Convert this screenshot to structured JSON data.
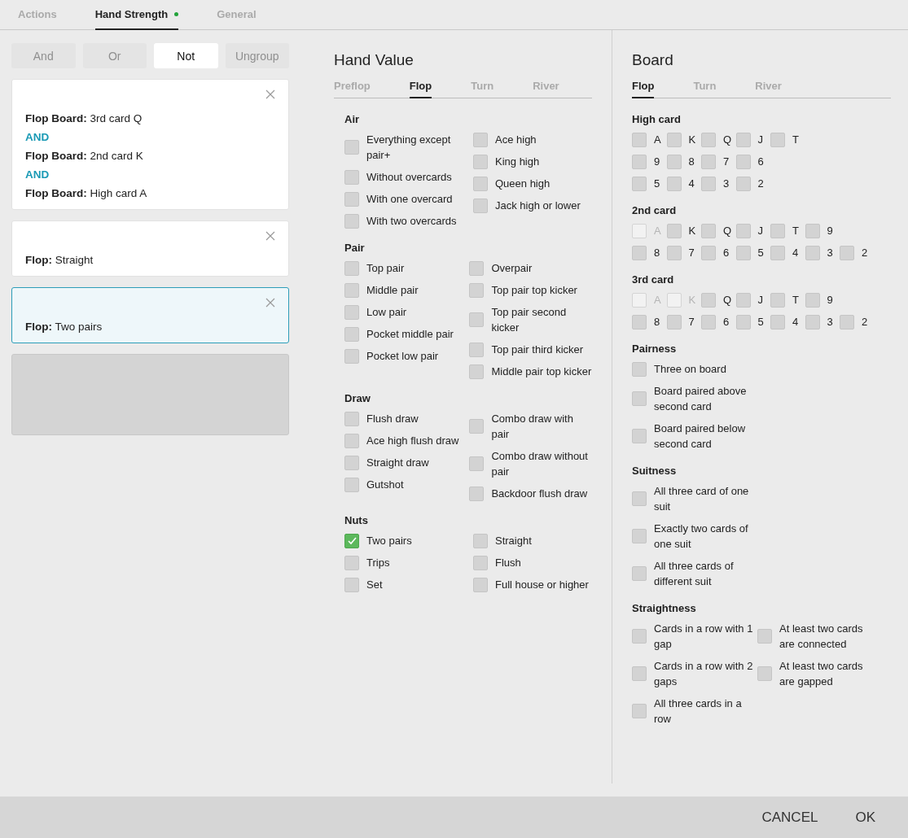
{
  "tabs": [
    {
      "label": "Actions",
      "selected": false,
      "dot": false
    },
    {
      "label": "Hand Strength",
      "selected": true,
      "dot": true
    },
    {
      "label": "General",
      "selected": false,
      "dot": false
    }
  ],
  "logic_buttons": [
    {
      "label": "And",
      "disabled": true
    },
    {
      "label": "Or",
      "disabled": true
    },
    {
      "label": "Not",
      "disabled": false
    },
    {
      "label": "Ungroup",
      "disabled": true
    }
  ],
  "conditions": [
    {
      "selected": false,
      "lines": [
        {
          "kind": "condition",
          "text": "**Flop Board:** 3rd card Q"
        },
        {
          "kind": "operator",
          "text": "AND"
        },
        {
          "kind": "condition",
          "text": "**Flop Board:** 2nd card K"
        },
        {
          "kind": "operator",
          "text": "AND"
        },
        {
          "kind": "condition",
          "text": "**Flop Board:** High card A"
        }
      ]
    },
    {
      "selected": false,
      "lines": [
        {
          "kind": "condition",
          "text": "**Flop:** Straight"
        }
      ]
    },
    {
      "selected": true,
      "lines": [
        {
          "kind": "condition",
          "text": "**Flop:** Two pairs"
        }
      ]
    }
  ],
  "hand_value": {
    "title": "Hand Value",
    "tabs": [
      {
        "label": "Preflop",
        "selected": false
      },
      {
        "label": "Flop",
        "selected": true
      },
      {
        "label": "Turn",
        "selected": false
      },
      {
        "label": "River",
        "selected": false
      }
    ],
    "sections": [
      {
        "title": "Air",
        "columns": [
          [
            {
              "label": "Everything except pair+",
              "checked": false
            },
            {
              "label": "Without overcards",
              "checked": false
            },
            {
              "label": "With one overcard",
              "checked": false
            },
            {
              "label": "With two overcards",
              "checked": false
            }
          ],
          [
            {
              "label": "Ace high",
              "checked": false
            },
            {
              "label": "King high",
              "checked": false
            },
            {
              "label": "Queen high",
              "checked": false
            },
            {
              "label": "Jack high or lower",
              "checked": false
            }
          ]
        ]
      },
      {
        "title": "Pair",
        "columns": [
          [
            {
              "label": "Top pair",
              "checked": false
            },
            {
              "label": "Middle pair",
              "checked": false
            },
            {
              "label": "Low pair",
              "checked": false
            },
            {
              "label": "Pocket middle pair",
              "checked": false
            },
            {
              "label": "Pocket low pair",
              "checked": false
            }
          ],
          [
            {
              "label": "Overpair",
              "checked": false
            },
            {
              "label": "Top pair top kicker",
              "checked": false
            },
            {
              "label": "Top pair second kicker",
              "checked": false
            },
            {
              "label": "Top pair third kicker",
              "checked": false
            },
            {
              "label": "Middle pair top kicker",
              "checked": false
            }
          ]
        ]
      },
      {
        "title": "Draw",
        "columns": [
          [
            {
              "label": "Flush draw",
              "checked": false
            },
            {
              "label": "Ace high flush draw",
              "checked": false
            },
            {
              "label": "Straight draw",
              "checked": false
            },
            {
              "label": "Gutshot",
              "checked": false
            }
          ],
          [
            {
              "label": "Combo draw with pair",
              "checked": false
            },
            {
              "label": "Combo draw without pair",
              "checked": false
            },
            {
              "label": "Backdoor flush draw",
              "checked": false
            }
          ]
        ]
      },
      {
        "title": "Nuts",
        "columns": [
          [
            {
              "label": "Two pairs",
              "checked": true
            },
            {
              "label": "Trips",
              "checked": false
            },
            {
              "label": "Set",
              "checked": false
            }
          ],
          [
            {
              "label": "Straight",
              "checked": false
            },
            {
              "label": "Flush",
              "checked": false
            },
            {
              "label": "Full house or higher",
              "checked": false
            }
          ]
        ]
      }
    ]
  },
  "board": {
    "title": "Board",
    "tabs": [
      {
        "label": "Flop",
        "selected": true
      },
      {
        "label": "Turn",
        "selected": false
      },
      {
        "label": "River",
        "selected": false
      }
    ],
    "sections": [
      {
        "title": "High card",
        "kind": "cards",
        "rows": [
          [
            {
              "label": "A",
              "checked": false,
              "disabled": false
            },
            {
              "label": "K",
              "checked": false,
              "disabled": false
            },
            {
              "label": "Q",
              "checked": false,
              "disabled": false
            },
            {
              "label": "J",
              "checked": false,
              "disabled": false
            },
            {
              "label": "T",
              "checked": false,
              "disabled": false
            }
          ],
          [
            {
              "label": "9",
              "checked": false,
              "disabled": false
            },
            {
              "label": "8",
              "checked": false,
              "disabled": false
            },
            {
              "label": "7",
              "checked": false,
              "disabled": false
            },
            {
              "label": "6",
              "checked": false,
              "disabled": false
            }
          ],
          [
            {
              "label": "5",
              "checked": false,
              "disabled": false
            },
            {
              "label": "4",
              "checked": false,
              "disabled": false
            },
            {
              "label": "3",
              "checked": false,
              "disabled": false
            },
            {
              "label": "2",
              "checked": false,
              "disabled": false
            }
          ]
        ]
      },
      {
        "title": "2nd card",
        "kind": "cards",
        "rows": [
          [
            {
              "label": "A",
              "checked": false,
              "disabled": true
            },
            {
              "label": "K",
              "checked": false,
              "disabled": false
            },
            {
              "label": "Q",
              "checked": false,
              "disabled": false
            },
            {
              "label": "J",
              "checked": false,
              "disabled": false
            },
            {
              "label": "T",
              "checked": false,
              "disabled": false
            },
            {
              "label": "9",
              "checked": false,
              "disabled": false
            }
          ],
          [
            {
              "label": "8",
              "checked": false,
              "disabled": false
            },
            {
              "label": "7",
              "checked": false,
              "disabled": false
            },
            {
              "label": "6",
              "checked": false,
              "disabled": false
            },
            {
              "label": "5",
              "checked": false,
              "disabled": false
            },
            {
              "label": "4",
              "checked": false,
              "disabled": false
            },
            {
              "label": "3",
              "checked": false,
              "disabled": false
            },
            {
              "label": "2",
              "checked": false,
              "disabled": false
            }
          ]
        ]
      },
      {
        "title": "3rd card",
        "kind": "cards",
        "rows": [
          [
            {
              "label": "A",
              "checked": false,
              "disabled": true
            },
            {
              "label": "K",
              "checked": false,
              "disabled": true
            },
            {
              "label": "Q",
              "checked": false,
              "disabled": false
            },
            {
              "label": "J",
              "checked": false,
              "disabled": false
            },
            {
              "label": "T",
              "checked": false,
              "disabled": false
            },
            {
              "label": "9",
              "checked": false,
              "disabled": false
            }
          ],
          [
            {
              "label": "8",
              "checked": false,
              "disabled": false
            },
            {
              "label": "7",
              "checked": false,
              "disabled": false
            },
            {
              "label": "6",
              "checked": false,
              "disabled": false
            },
            {
              "label": "5",
              "checked": false,
              "disabled": false
            },
            {
              "label": "4",
              "checked": false,
              "disabled": false
            },
            {
              "label": "3",
              "checked": false,
              "disabled": false
            },
            {
              "label": "2",
              "checked": false,
              "disabled": false
            }
          ]
        ]
      },
      {
        "title": "Pairness",
        "kind": "list",
        "columns": [
          [
            {
              "label": "Three on board",
              "checked": false
            },
            {
              "label": "Board paired above second card",
              "checked": false
            },
            {
              "label": "Board paired below second card",
              "checked": false
            }
          ]
        ]
      },
      {
        "title": "Suitness",
        "kind": "list",
        "columns": [
          [
            {
              "label": "All three card of one suit",
              "checked": false
            },
            {
              "label": "Exactly two cards of one suit",
              "checked": false
            },
            {
              "label": "All three cards of different suit",
              "checked": false
            }
          ]
        ]
      },
      {
        "title": "Straightness",
        "kind": "list",
        "columns": [
          [
            {
              "label": "Cards in a row with 1 gap",
              "checked": false
            },
            {
              "label": "Cards in a row with 2 gaps",
              "checked": false
            },
            {
              "label": "All three cards in a row",
              "checked": false
            }
          ],
          [
            {
              "label": "At least two cards are connected",
              "checked": false
            },
            {
              "label": "At least two cards are gapped",
              "checked": false
            }
          ]
        ]
      }
    ]
  },
  "footer_buttons": [
    {
      "label": "CANCEL"
    },
    {
      "label": "OK"
    }
  ]
}
